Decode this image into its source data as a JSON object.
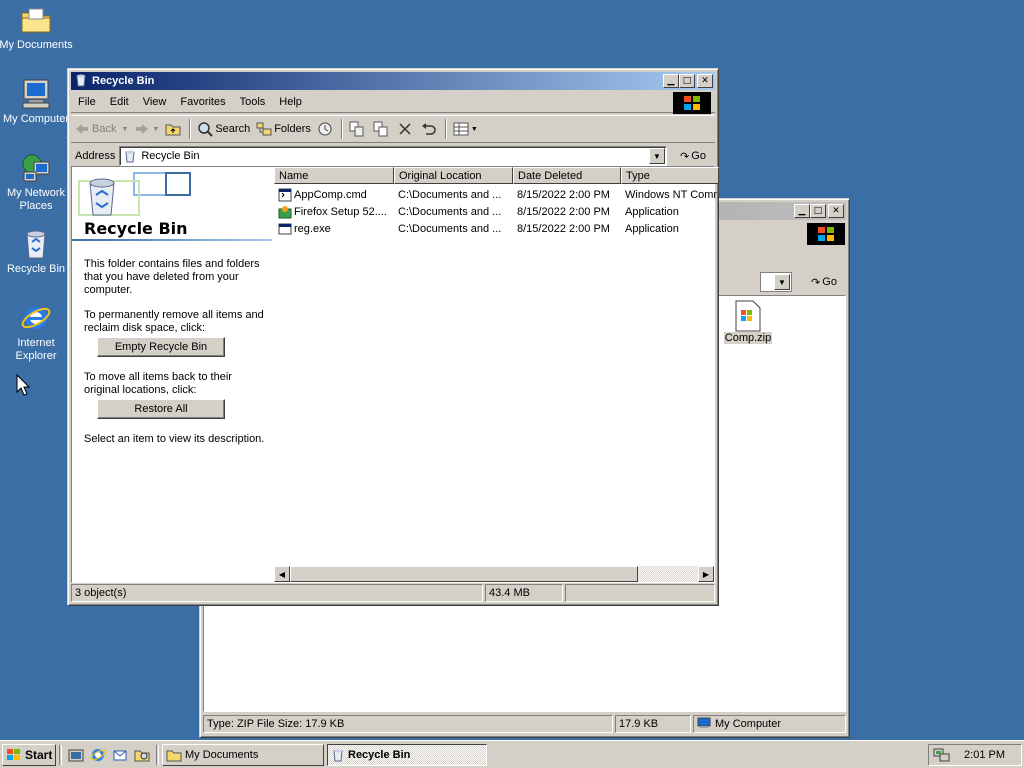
{
  "desktop": {
    "icons": [
      {
        "label": "My Documents",
        "icon": "folder-icon"
      },
      {
        "label": "My Computer",
        "icon": "computer-icon"
      },
      {
        "label": "My Network\nPlaces",
        "icon": "network-icon"
      },
      {
        "label": "Recycle Bin",
        "icon": "recycle-bin-icon"
      },
      {
        "label": "Internet\nExplorer",
        "icon": "ie-icon"
      }
    ]
  },
  "back_window": {
    "go_label": "Go",
    "file_label": "Comp.zip",
    "status": {
      "left": "Type: ZIP File Size: 17.9 KB",
      "size": "17.9 KB",
      "zone": "My Computer"
    }
  },
  "recycle_window": {
    "title": "Recycle Bin",
    "menu": [
      "File",
      "Edit",
      "View",
      "Favorites",
      "Tools",
      "Help"
    ],
    "toolbar": {
      "back": "Back",
      "search": "Search",
      "folders": "Folders"
    },
    "address": {
      "label": "Address",
      "value": "Recycle Bin",
      "go": "Go"
    },
    "left_pane": {
      "title": "Recycle Bin",
      "intro": "This folder contains files and folders that you have deleted from your computer.",
      "empty_text": "To permanently remove all items and reclaim disk space, click:",
      "empty_button": "Empty Recycle Bin",
      "restore_text": "To move all items back to their original locations, click:",
      "restore_button": "Restore All",
      "select_text": "Select an item to view its description."
    },
    "columns": [
      "Name",
      "Original Location",
      "Date Deleted",
      "Type"
    ],
    "rows": [
      {
        "name": "AppComp.cmd",
        "location": "C:\\Documents and ...",
        "date": "8/15/2022 2:00 PM",
        "type": "Windows NT Comm",
        "icon": "cmd-file-icon"
      },
      {
        "name": "Firefox Setup 52....",
        "location": "C:\\Documents and ...",
        "date": "8/15/2022 2:00 PM",
        "type": "Application",
        "icon": "installer-icon"
      },
      {
        "name": "reg.exe",
        "location": "C:\\Documents and ...",
        "date": "8/15/2022 2:00 PM",
        "type": "Application",
        "icon": "exe-icon"
      }
    ],
    "status": {
      "objects": "3 object(s)",
      "size": "43.4 MB"
    }
  },
  "taskbar": {
    "start": "Start",
    "tasks": [
      {
        "label": "My Documents"
      },
      {
        "label": "Recycle Bin"
      }
    ],
    "clock": "2:01 PM"
  },
  "colors": {
    "desktop": "#3a6ea5",
    "title_active": "#0a246a",
    "face": "#d4d0c8"
  }
}
